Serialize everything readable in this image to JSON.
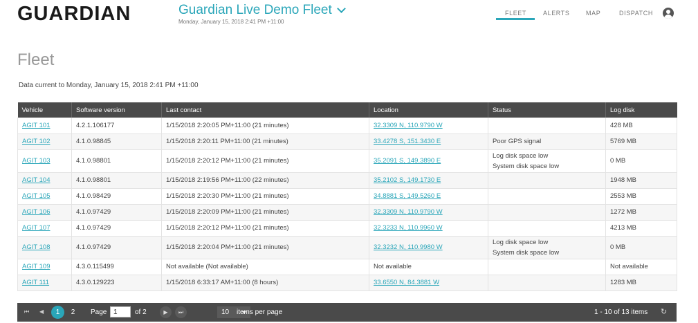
{
  "header": {
    "logo_text": "GUARDIAN",
    "fleet_title": "Guardian Live Demo Fleet",
    "fleet_subtitle": "Monday, January 15, 2018 2:41 PM +11:00",
    "nav": [
      {
        "label": "FLEET",
        "active": true
      },
      {
        "label": "ALERTS",
        "active": false
      },
      {
        "label": "MAP",
        "active": false
      },
      {
        "label": "DISPATCH",
        "active": false
      }
    ],
    "accent_color": "#2aa6b9"
  },
  "page": {
    "title": "Fleet",
    "data_current": "Data current to Monday, January 15, 2018 2:41 PM +11:00"
  },
  "table": {
    "columns": [
      "Vehicle",
      "Software version",
      "Last contact",
      "Location",
      "Status",
      "Log disk"
    ],
    "rows": [
      {
        "vehicle": "AGIT 101",
        "software": "4.2.1.106177",
        "last_contact": "1/15/2018 2:20:05 PM+11:00 (21 minutes)",
        "location": "32.3309 N, 110.9790 W",
        "status": [],
        "log_disk": "428 MB"
      },
      {
        "vehicle": "AGIT 102",
        "software": "4.1.0.98845",
        "last_contact": "1/15/2018 2:20:11 PM+11:00 (21 minutes)",
        "location": "33.4278 S, 151.3430 E",
        "status": [
          "Poor GPS signal"
        ],
        "log_disk": "5769 MB"
      },
      {
        "vehicle": "AGIT 103",
        "software": "4.1.0.98801",
        "last_contact": "1/15/2018 2:20:12 PM+11:00 (21 minutes)",
        "location": "35.2091 S, 149.3890 E",
        "status": [
          "Log disk space low",
          "System disk space low"
        ],
        "log_disk": "0 MB"
      },
      {
        "vehicle": "AGIT 104",
        "software": "4.1.0.98801",
        "last_contact": "1/15/2018 2:19:56 PM+11:00 (22 minutes)",
        "location": "35.2102 S, 149.1730 E",
        "status": [],
        "log_disk": "1948 MB"
      },
      {
        "vehicle": "AGIT 105",
        "software": "4.1.0.98429",
        "last_contact": "1/15/2018 2:20:30 PM+11:00 (21 minutes)",
        "location": "34.8881 S, 149.5260 E",
        "status": [],
        "log_disk": "2553 MB"
      },
      {
        "vehicle": "AGIT 106",
        "software": "4.1.0.97429",
        "last_contact": "1/15/2018 2:20:09 PM+11:00 (21 minutes)",
        "location": "32.3309 N, 110.9790 W",
        "status": [],
        "log_disk": "1272 MB"
      },
      {
        "vehicle": "AGIT 107",
        "software": "4.1.0.97429",
        "last_contact": "1/15/2018 2:20:12 PM+11:00 (21 minutes)",
        "location": "32.3233 N, 110.9960 W",
        "status": [],
        "log_disk": "4213 MB"
      },
      {
        "vehicle": "AGIT 108",
        "software": "4.1.0.97429",
        "last_contact": "1/15/2018 2:20:04 PM+11:00 (21 minutes)",
        "location": "32.3232 N, 110.9980 W",
        "status": [
          "Log disk space low",
          "System disk space low"
        ],
        "log_disk": "0 MB"
      },
      {
        "vehicle": "AGIT 109",
        "software": "4.3.0.115499",
        "last_contact": "Not available (Not available)",
        "location": "Not available",
        "status": [],
        "log_disk": "Not available",
        "location_link": false
      },
      {
        "vehicle": "AGIT 111",
        "software": "4.3.0.129223",
        "last_contact": "1/15/2018 6:33:17 AM+11:00 (8 hours)",
        "location": "33.6550 N, 84.3881 W",
        "status": [],
        "log_disk": "1283 MB"
      }
    ]
  },
  "pager": {
    "first_icon": "first-page-icon",
    "prev_icon": "prev-page-icon",
    "pages": [
      "1",
      "2"
    ],
    "current_page": "1",
    "page_label": "Page",
    "page_input_value": "1",
    "of_label": "of 2",
    "next_icon": "next-page-icon",
    "last_icon": "last-page-icon",
    "per_page_value": "10",
    "per_page_label": "items per page",
    "summary": "1 - 10 of 13 items",
    "refresh_icon": "refresh-icon"
  }
}
